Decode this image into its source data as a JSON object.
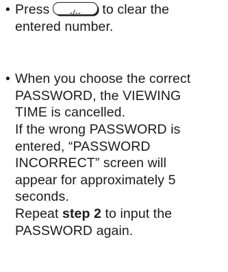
{
  "bullet": "•",
  "item1": {
    "pre": "Press",
    "key_label": "-/--",
    "post": "to clear the",
    "line2": "entered number."
  },
  "item2": {
    "lines": [
      "When you choose the correct",
      "PASSWORD, the VIEWING",
      "TIME is cancelled.",
      "If the wrong PASSWORD is",
      "entered, “PASSWORD",
      "INCORRECT” screen will",
      "appear for approximately 5",
      "seconds."
    ],
    "repeat_pre": "Repeat",
    "repeat_bold": "step 2",
    "repeat_post": "to input the",
    "last_line": "PASSWORD again."
  }
}
